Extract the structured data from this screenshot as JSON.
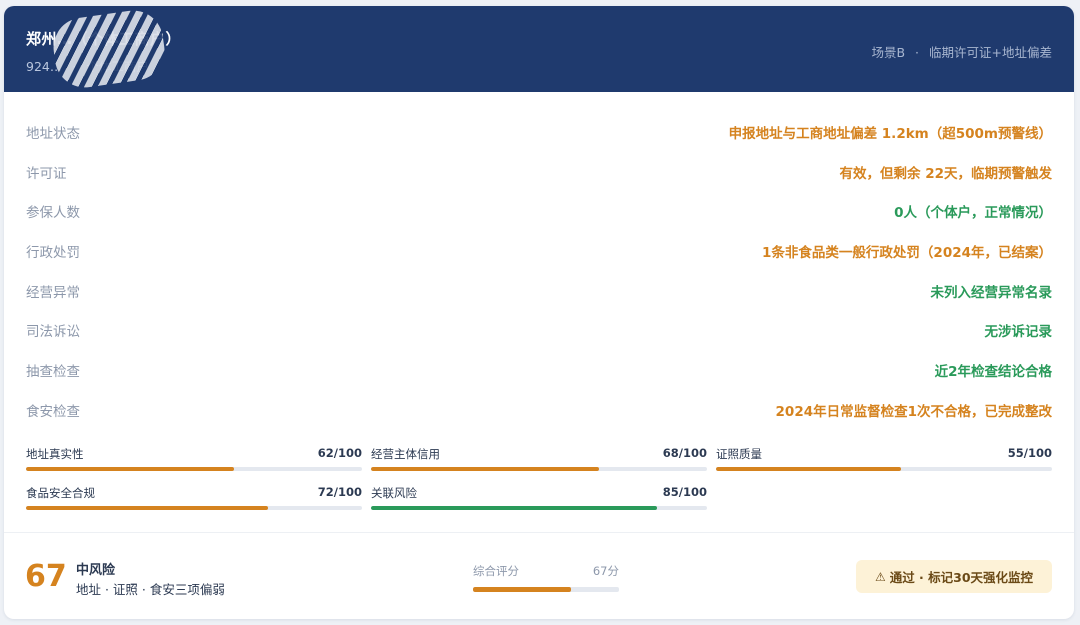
{
  "header": {
    "title": "郑州…（个体工商户）",
    "code": "924…",
    "type": "个体工商户",
    "scene": "场景B",
    "scene_desc": "临期许可证+地址偏差",
    "separator": "·"
  },
  "colors": {
    "warning": "#d5831f",
    "ok": "#2a9a5a",
    "header_bg": "#1f3a6e"
  },
  "rows": [
    {
      "label": "地址状态",
      "value": "申报地址与工商地址偏差 1.2km（超500m预警线）",
      "status": "warning"
    },
    {
      "label": "许可证",
      "value": "有效，但剩余 22天，临期预警触发",
      "status": "warning"
    },
    {
      "label": "参保人数",
      "value": "0人（个体户，正常情况）",
      "status": "ok"
    },
    {
      "label": "行政处罚",
      "value": "1条非食品类一般行政处罚（2024年，已结案）",
      "status": "warning"
    },
    {
      "label": "经营异常",
      "value": "未列入经营异常名录",
      "status": "ok"
    },
    {
      "label": "司法诉讼",
      "value": "无涉诉记录",
      "status": "ok"
    },
    {
      "label": "抽查检查",
      "value": "近2年检查结论合格",
      "status": "ok"
    },
    {
      "label": "食安检查",
      "value": "2024年日常监督检查1次不合格，已完成整改",
      "status": "warning"
    }
  ],
  "scores": [
    {
      "label": "地址真实性",
      "score": "62/100",
      "value": 62,
      "status": "warning"
    },
    {
      "label": "经营主体信用",
      "score": "68/100",
      "value": 68,
      "status": "warning"
    },
    {
      "label": "证照质量",
      "score": "55/100",
      "value": 55,
      "status": "warning"
    },
    {
      "label": "食品安全合规",
      "score": "72/100",
      "value": 72,
      "status": "warning"
    },
    {
      "label": "关联风险",
      "score": "85/100",
      "value": 85,
      "status": "ok"
    }
  ],
  "footer": {
    "score": "67",
    "level": "中风险",
    "desc": "地址 · 证照 · 食安三项偏弱",
    "overall_label": "综合评分",
    "overall_value": "67分",
    "overall_percent": 67,
    "verdict": "通过 · 标记30天强化监控",
    "verdict_icon": "warning-triangle-icon"
  }
}
